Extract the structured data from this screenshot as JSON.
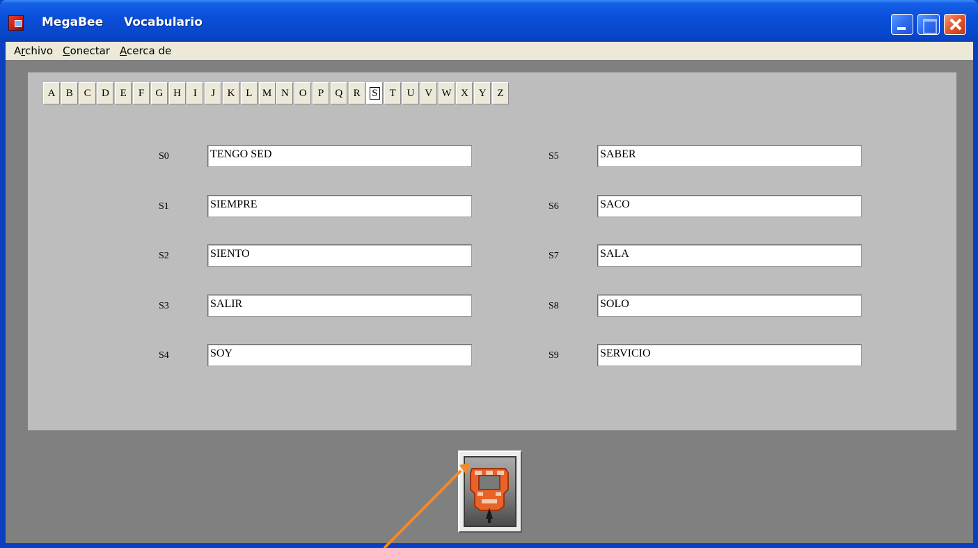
{
  "window": {
    "title_app": "MegaBee",
    "title_doc": "Vocabulario",
    "icon": "megabee-app-icon",
    "controls": [
      "minimize-icon",
      "maximize-icon",
      "close-icon"
    ]
  },
  "menu": {
    "items": [
      {
        "pre": "A",
        "ul": "r",
        "post": "chivo"
      },
      {
        "pre": "",
        "ul": "C",
        "post": "onectar"
      },
      {
        "pre": "",
        "ul": "A",
        "post": "cerca de"
      }
    ]
  },
  "letters": [
    "A",
    "B",
    "C",
    "D",
    "E",
    "F",
    "G",
    "H",
    "I",
    "J",
    "K",
    "L",
    "M",
    "N",
    "O",
    "P",
    "Q",
    "R",
    "S",
    "T",
    "U",
    "V",
    "W",
    "X",
    "Y",
    "Z"
  ],
  "selected_letter": "S",
  "vocab": {
    "left": [
      {
        "label": "S0",
        "value": "TENGO SED"
      },
      {
        "label": "S1",
        "value": "SIEMPRE"
      },
      {
        "label": "S2",
        "value": "SIENTO"
      },
      {
        "label": "S3",
        "value": "SALIR"
      },
      {
        "label": "S4",
        "value": "SOY"
      }
    ],
    "right": [
      {
        "label": "S5",
        "value": "SABER"
      },
      {
        "label": "S6",
        "value": "SACO"
      },
      {
        "label": "S7",
        "value": "SALA"
      },
      {
        "label": "S8",
        "value": "SOLO"
      },
      {
        "label": "S9",
        "value": "SERVICIO"
      }
    ]
  },
  "connect_button": {
    "icon": "megabee-device-icon"
  },
  "colors": {
    "titlebar": "#0a4fd9",
    "client_bg": "#808080",
    "panel_bg": "#bdbdbd",
    "annotation_arrow": "#f28a2a"
  }
}
